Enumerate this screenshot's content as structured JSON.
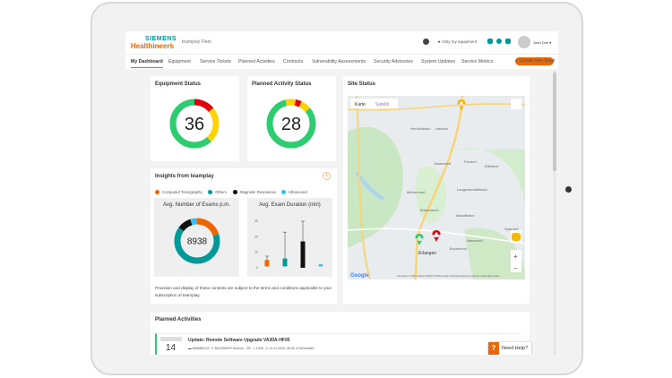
{
  "header": {
    "brand_top": "SIEMENS",
    "brand_bottom": "Healthineers",
    "app_name": "teamplay Fleet",
    "only_my_equipment": "Only my equipment",
    "user_name": "John Doe"
  },
  "nav": {
    "items": [
      "My Dashboard",
      "Equipment",
      "Service Tickets",
      "Planned Activities",
      "Contracts",
      "Vulnerability Assessments",
      "Security Advisories",
      "System Updates",
      "Service Metrics"
    ],
    "active": "My Dashboard",
    "create_ticket": "+ Create new ticket"
  },
  "equipment_status": {
    "title": "Equipment Status",
    "total": "36",
    "segments": [
      {
        "status": "critical",
        "color": "#e2000f",
        "fraction": 0.14
      },
      {
        "status": "warning",
        "color": "#ffd200",
        "fraction": 0.24
      },
      {
        "status": "ok",
        "color": "#2ecc71",
        "fraction": 0.62
      }
    ]
  },
  "planned_activity_status": {
    "title": "Planned Activity Status",
    "total": "28",
    "segments": [
      {
        "status": "warning",
        "color": "#ffd200",
        "fraction": 0.03
      },
      {
        "status": "critical",
        "color": "#e2000f",
        "fraction": 0.04
      },
      {
        "status": "warning",
        "color": "#ffd200",
        "fraction": 0.07
      },
      {
        "status": "ok",
        "color": "#2ecc71",
        "fraction": 0.82
      },
      {
        "status": "warning",
        "color": "#ffd200",
        "fraction": 0.04
      }
    ]
  },
  "site_status": {
    "title": "Site Status",
    "map_tabs": [
      "Karte",
      "Satellit"
    ],
    "places": [
      "Erlangen",
      "Baiersdorf",
      "Möhrendorf",
      "Bubenreuth",
      "Marloffstein",
      "Langensendelbach",
      "Poxdorf",
      "Effeltrich",
      "Hausen",
      "Heroldsbach",
      "Buckenhof",
      "Uttenreuth",
      "Spardorf"
    ],
    "attribution": "Kartendaten © 2020 GeoBasis-DE/BKG (©2009) Google  Nutzungsbedingungen  Fehler bei Google Maps melden",
    "google": "Google",
    "pins": [
      {
        "color": "#f5b800"
      },
      {
        "color": "#2ecc71"
      },
      {
        "color": "#e2000f"
      }
    ]
  },
  "insights": {
    "title": "Insights from teamplay",
    "info_icon": "info-icon",
    "legend": [
      {
        "label": "Computed Tomography",
        "color": "#ec6602"
      },
      {
        "label": "Others",
        "color": "#009999"
      },
      {
        "label": "Magnetic Resonance",
        "color": "#111111"
      },
      {
        "label": "Ultrasound",
        "color": "#3abfef"
      }
    ],
    "disclaimer": "Provision and display of these contents are subject to the terms and conditions applicable to your subscription of teamplay."
  },
  "chart_data": [
    {
      "type": "pie",
      "title": "Avg. Number of Exams p.m.",
      "center_label": "8938",
      "categories": [
        "Computed Tomography",
        "Others",
        "Magnetic Resonance",
        "Ultrasound"
      ],
      "values": [
        0.2,
        0.65,
        0.1,
        0.05
      ]
    },
    {
      "type": "box",
      "title": "Avg. Exam Duration (min)",
      "ylim": [
        0,
        30
      ],
      "yticks": [
        "0",
        "10",
        "20",
        "30"
      ],
      "categories": [
        "Computed Tomography",
        "Others",
        "Magnetic Resonance",
        "Ultrasound"
      ],
      "boxes": [
        {
          "min": 0.5,
          "q1": 1,
          "q3": 5,
          "max": 7.5
        },
        {
          "min": 0.5,
          "q1": 1,
          "q3": 6,
          "max": 23
        },
        {
          "min": 0,
          "q1": 0,
          "q3": 17,
          "max": 30
        },
        {
          "min": 1,
          "q1": 1,
          "q3": 2,
          "max": 2
        }
      ]
    }
  ],
  "planned_activities": {
    "title": "Planned Activities",
    "items": [
      {
        "day": "14",
        "title": "Update: Remote Software Upgrade VA30A-HF05",
        "serial": "6666663.03",
        "site": "BIOGRAPH Horizon - 3R",
        "type": "LINK",
        "date": "14.11.2020, 08:30",
        "status": "Scheduled"
      }
    ]
  },
  "help": {
    "label": "Need Help?",
    "icon": "?"
  }
}
